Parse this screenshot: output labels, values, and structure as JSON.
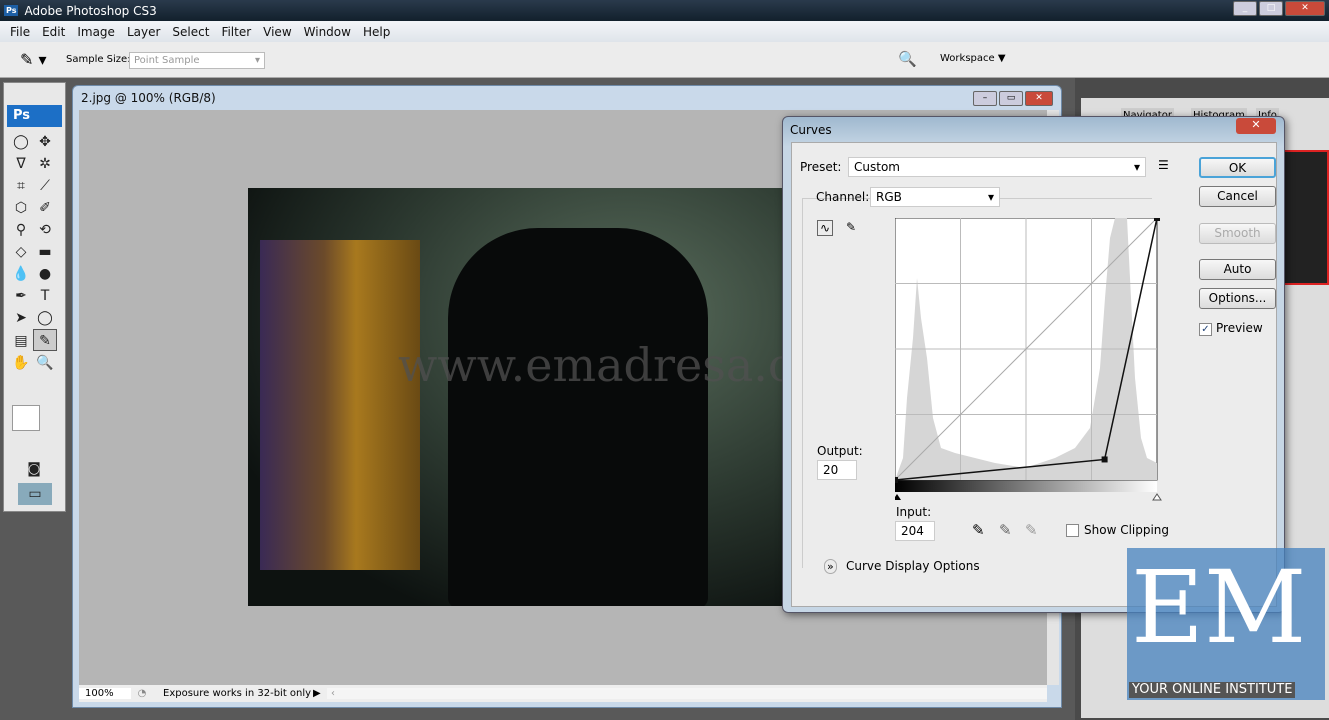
{
  "app": {
    "title": "Adobe Photoshop CS3",
    "logo": "Ps"
  },
  "menu": [
    "File",
    "Edit",
    "Image",
    "Layer",
    "Select",
    "Filter",
    "View",
    "Window",
    "Help"
  ],
  "options": {
    "sample_size_label": "Sample Size:",
    "sample_size_value": "Point Sample",
    "workspace": "Workspace ▼"
  },
  "toolbox": {
    "logo": "Ps"
  },
  "document": {
    "title": "2.jpg @ 100% (RGB/8)",
    "zoom": "100%",
    "status": "Exposure works in 32-bit only",
    "watermark": "www.emadresa.com"
  },
  "panels": {
    "tabs": [
      "Navigator",
      "Histogram",
      "Info"
    ]
  },
  "curves": {
    "title": "Curves",
    "preset_label": "Preset:",
    "preset_value": "Custom",
    "channel_label": "Channel:",
    "channel_value": "RGB",
    "buttons": {
      "ok": "OK",
      "cancel": "Cancel",
      "smooth": "Smooth",
      "auto": "Auto",
      "options": "Options..."
    },
    "preview_label": "Preview",
    "preview_checked": true,
    "output_label": "Output:",
    "output_value": "20",
    "input_label": "Input:",
    "input_value": "204",
    "show_clipping_label": "Show Clipping",
    "show_clipping_checked": false,
    "display_options_label": "Curve Display Options",
    "curve_points": [
      [
        0,
        0
      ],
      [
        204,
        20
      ],
      [
        255,
        255
      ]
    ]
  },
  "brand": {
    "logo": "EM",
    "tagline": "YOUR ONLINE INSTITUTE"
  }
}
